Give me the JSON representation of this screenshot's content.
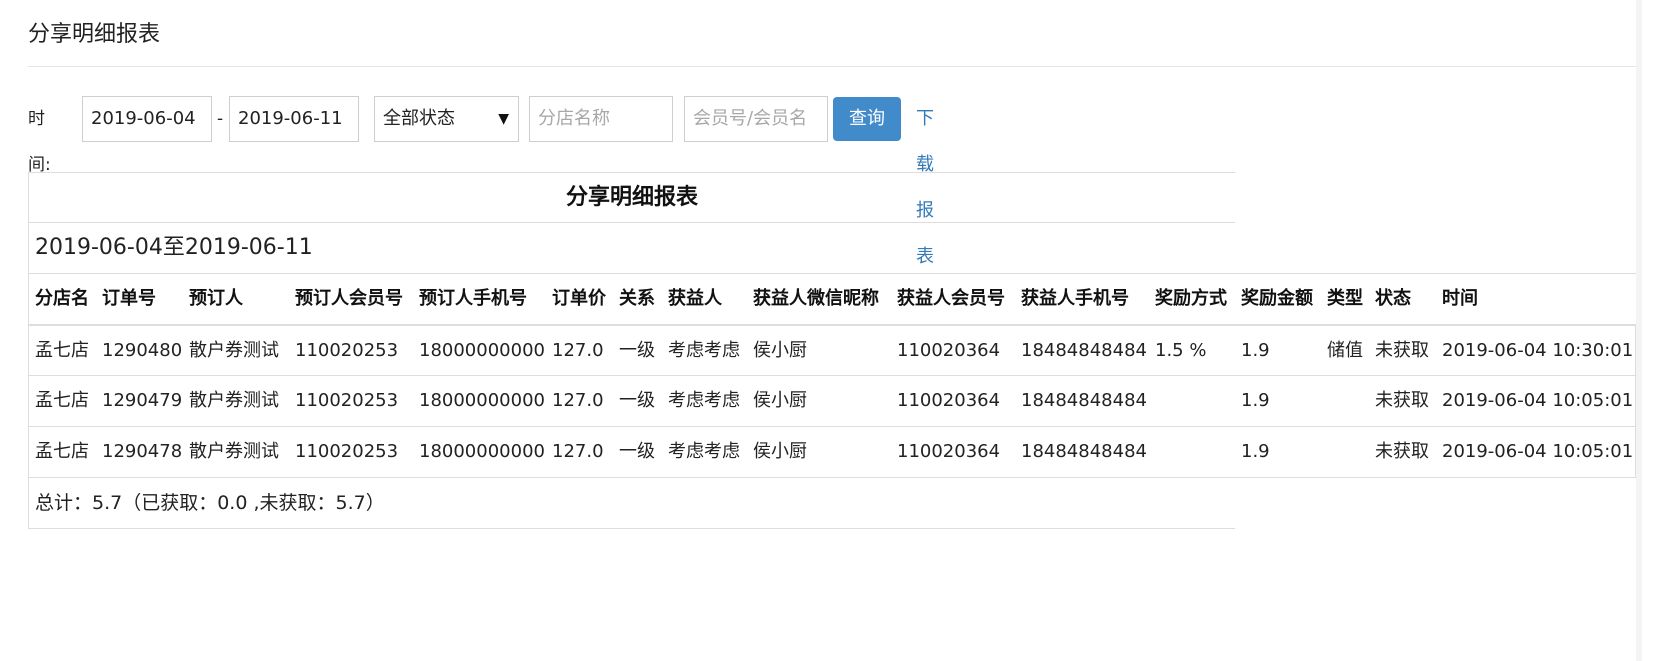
{
  "page": {
    "title": "分享明细报表"
  },
  "filters": {
    "time_label": "时间:",
    "start_date": "2019-06-04",
    "separator": "-",
    "end_date": "2019-06-11",
    "status_selected": "全部状态",
    "branch_placeholder": "分店名称",
    "member_placeholder": "会员号/会员名",
    "query_label": "查询",
    "download_label": "下载报表"
  },
  "report": {
    "title": "分享明细报表",
    "date_range": "2019-06-04至2019-06-11",
    "columns": [
      "分店名",
      "订单号",
      "预订人",
      "预订人会员号",
      "预订人手机号",
      "订单价",
      "关系",
      "获益人",
      "获益人微信昵称",
      "获益人会员号",
      "获益人手机号",
      "奖励方式",
      "奖励金额",
      "类型",
      "状态",
      "时间"
    ],
    "rows": [
      [
        "孟七店",
        "1290480",
        "散户券测试",
        "110020253",
        "18000000000",
        "127.0",
        "一级",
        "考虑考虑",
        "侯小厨",
        "110020364",
        "18484848484",
        "1.5 %",
        "1.9",
        "储值",
        "未获取",
        "2019-06-04 10:30:01"
      ],
      [
        "孟七店",
        "1290479",
        "散户券测试",
        "110020253",
        "18000000000",
        "127.0",
        "一级",
        "考虑考虑",
        "侯小厨",
        "110020364",
        "18484848484",
        "",
        "1.9",
        "",
        "未获取",
        "2019-06-04 10:05:01"
      ],
      [
        "孟七店",
        "1290478",
        "散户券测试",
        "110020253",
        "18000000000",
        "127.0",
        "一级",
        "考虑考虑",
        "侯小厨",
        "110020364",
        "18484848484",
        "",
        "1.9",
        "",
        "未获取",
        "2019-06-04 10:05:01"
      ]
    ],
    "total": "总计：5.7（已获取：0.0 ,未获取：5.7）"
  },
  "colors": {
    "primary_button": "#428bca",
    "link": "#337ab7",
    "border": "#dddddd"
  }
}
